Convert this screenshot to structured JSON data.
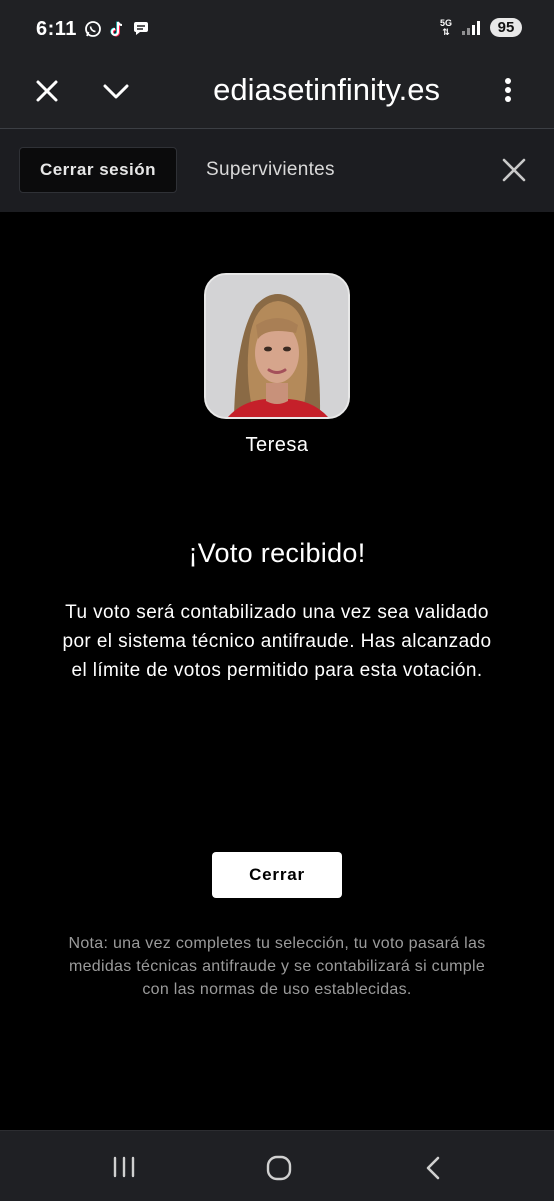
{
  "status_bar": {
    "time": "6:11",
    "app_icons": [
      "whatsapp-icon",
      "tiktok-icon",
      "chat-icon"
    ],
    "network": "5G",
    "battery": "95"
  },
  "browser": {
    "url": "ediasetinfinity.es",
    "icons": [
      "close-icon",
      "chevron-down-icon",
      "more-vert-icon"
    ]
  },
  "top_nav": {
    "logout_label": "Cerrar sesión",
    "title": "Supervivientes"
  },
  "contestant": {
    "name": "Teresa"
  },
  "confirmation": {
    "title": "¡Voto recibido!",
    "message": "Tu voto será contabilizado una vez sea validado por el sistema técnico antifraude. Has alcanzado el límite de votos permitido para esta votación.",
    "close_label": "Cerrar",
    "note": "Nota: una vez completes tu selección, tu voto pasará las medidas técnicas antifraude y se contabilizará si cumple con las normas de uso establecidas."
  },
  "colors": {
    "background": "#000000",
    "bar": "#202124",
    "nav": "#1c1d21",
    "note_text": "#9b9b9b",
    "shirt": "#c5202a"
  }
}
